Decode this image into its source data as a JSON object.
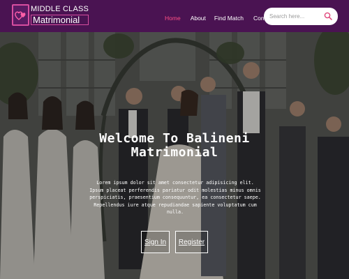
{
  "header": {
    "logo_line1": "MIDDLE CLASS",
    "logo_line2": "Matrimonial",
    "nav": [
      {
        "label": "Home",
        "active": true
      },
      {
        "label": "About"
      },
      {
        "label": "Find Match"
      },
      {
        "label": "Contact"
      }
    ],
    "search_placeholder": "Search here...",
    "search_icon": "search-icon"
  },
  "hero": {
    "title_line1": "Welcome To Balineni",
    "title_line2": "Matrimonial",
    "description": "Lorem ipsum dolor sit amet consectetur adipisicing elit. Ipsum placeat perferendis pariatur odit molestias minus omnis perspiciatis, praesentium consequuntur, ea consectetur saepe. Repellendus iure atque repudiandae sapiente voluptatum cum nulla.",
    "signin_label": "Sign In",
    "register_label": "Register"
  },
  "colors": {
    "navbar": "#4a1352",
    "active_nav": "#ff4f86",
    "logo_accent": "#d84ea0"
  }
}
